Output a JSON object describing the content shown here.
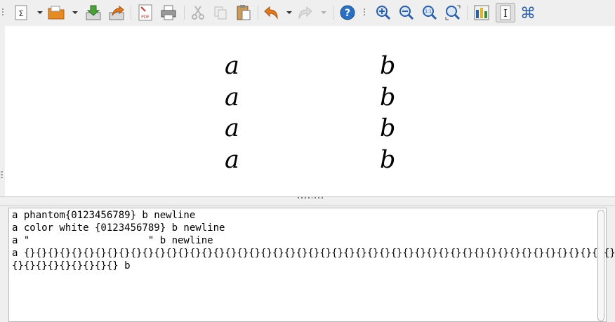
{
  "toolbar": {
    "items": [
      {
        "name": "elements-icon",
        "glyph": "Σ"
      },
      {
        "name": "open-folder-icon"
      },
      {
        "name": "save-download-icon"
      },
      {
        "name": "send-export-icon"
      },
      {
        "name": "export-pdf-icon",
        "glyph": "PDF"
      },
      {
        "name": "print-icon"
      },
      {
        "name": "cut-icon"
      },
      {
        "name": "copy-icon"
      },
      {
        "name": "paste-icon"
      },
      {
        "name": "undo-icon"
      },
      {
        "name": "redo-icon"
      },
      {
        "name": "help-icon",
        "glyph": "?"
      },
      {
        "name": "zoom-in-icon"
      },
      {
        "name": "zoom-out-icon"
      },
      {
        "name": "zoom-100-icon",
        "glyph": "1:1"
      },
      {
        "name": "show-all-icon"
      },
      {
        "name": "update-icon"
      },
      {
        "name": "formula-cursor-icon",
        "glyph": "I"
      },
      {
        "name": "symbols-icon",
        "glyph": "⌘"
      }
    ]
  },
  "document": {
    "rows": [
      {
        "left": "a",
        "right": "b"
      },
      {
        "left": "a",
        "right": "b"
      },
      {
        "left": "a",
        "right": "b"
      },
      {
        "left": "a",
        "right": "b"
      }
    ]
  },
  "editor": {
    "lines": [
      "a phantom{0123456789} b newline",
      "a color white {0123456789} b newline",
      "a \"                    \" b newline",
      "a {}{}{}{}{}{}{}{}{}{}{}{}{}{}{}{}{}{}{}{}{}{}{}{}{}{}{}{}{}{}{}{}{}{}{}{}{}{}{}{}{}{}{}{}{}{}{}{}{}{}",
      "{}{}{}{}{}{}{}{}{} b"
    ]
  },
  "colors": {
    "blue_icon": "#2a5ea8",
    "orange_icon": "#e07a1f",
    "green_icon": "#3d8a2e",
    "red_icon": "#c63a2f"
  }
}
